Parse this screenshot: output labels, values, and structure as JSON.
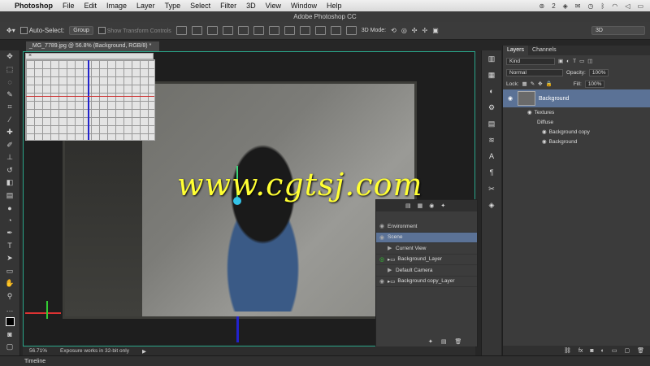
{
  "menubar": {
    "app": "Photoshop",
    "items": [
      "File",
      "Edit",
      "Image",
      "Layer",
      "Type",
      "Select",
      "Filter",
      "3D",
      "View",
      "Window",
      "Help"
    ],
    "status_badge": "2"
  },
  "window": {
    "title": "Adobe Photoshop CC"
  },
  "options": {
    "auto_select_label": "Auto-Select:",
    "auto_select_value": "Group",
    "transform_label": "Show Transform Controls",
    "mode_label": "3D Mode:",
    "workspace": "3D"
  },
  "document": {
    "tab": "_MG_7789.jpg @ 56.8% (Background, RGB/8) *"
  },
  "watermark": "www.cgtsj.com",
  "panel3d": {
    "items": [
      {
        "label": "Environment",
        "selected": false
      },
      {
        "label": "Scene",
        "selected": true
      },
      {
        "label": "Current View",
        "selected": false
      },
      {
        "label": "Background_Layer",
        "selected": false
      },
      {
        "label": "Default Camera",
        "selected": false
      },
      {
        "label": "Background copy_Layer",
        "selected": false
      }
    ]
  },
  "layers": {
    "tabs": [
      "Layers",
      "Channels"
    ],
    "filter": "Kind",
    "blend": "Normal",
    "opacity_label": "Opacity:",
    "opacity": "100%",
    "lock_label": "Lock:",
    "fill_label": "Fill:",
    "fill": "100%",
    "layer_name": "Background",
    "sublayers": [
      "Textures",
      "Diffuse",
      "Background copy",
      "Background"
    ]
  },
  "status": {
    "zoom": "56.71%",
    "message": "Exposure works in 32-bit only"
  },
  "timeline": {
    "label": "Timeline"
  }
}
